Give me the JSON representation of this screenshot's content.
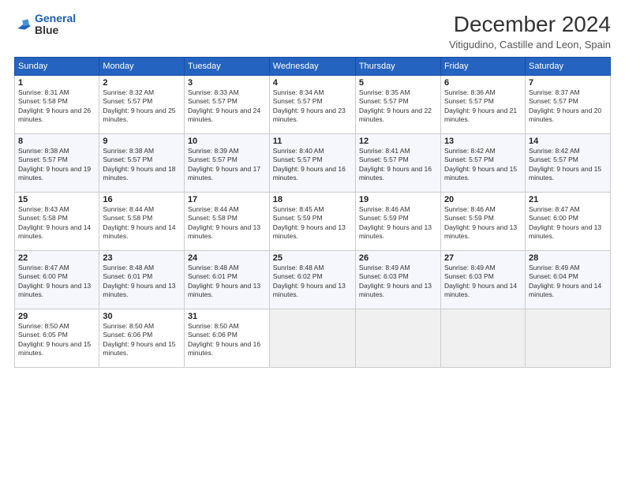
{
  "logo": {
    "line1": "General",
    "line2": "Blue"
  },
  "title": "December 2024",
  "subtitle": "Vitigudino, Castille and Leon, Spain",
  "weekdays": [
    "Sunday",
    "Monday",
    "Tuesday",
    "Wednesday",
    "Thursday",
    "Friday",
    "Saturday"
  ],
  "weeks": [
    [
      {
        "day": 1,
        "sunrise": "8:31 AM",
        "sunset": "5:58 PM",
        "daylight": "9 hours and 26 minutes."
      },
      {
        "day": 2,
        "sunrise": "8:32 AM",
        "sunset": "5:57 PM",
        "daylight": "9 hours and 25 minutes."
      },
      {
        "day": 3,
        "sunrise": "8:33 AM",
        "sunset": "5:57 PM",
        "daylight": "9 hours and 24 minutes."
      },
      {
        "day": 4,
        "sunrise": "8:34 AM",
        "sunset": "5:57 PM",
        "daylight": "9 hours and 23 minutes."
      },
      {
        "day": 5,
        "sunrise": "8:35 AM",
        "sunset": "5:57 PM",
        "daylight": "9 hours and 22 minutes."
      },
      {
        "day": 6,
        "sunrise": "8:36 AM",
        "sunset": "5:57 PM",
        "daylight": "9 hours and 21 minutes."
      },
      {
        "day": 7,
        "sunrise": "8:37 AM",
        "sunset": "5:57 PM",
        "daylight": "9 hours and 20 minutes."
      }
    ],
    [
      {
        "day": 8,
        "sunrise": "8:38 AM",
        "sunset": "5:57 PM",
        "daylight": "9 hours and 19 minutes."
      },
      {
        "day": 9,
        "sunrise": "8:38 AM",
        "sunset": "5:57 PM",
        "daylight": "9 hours and 18 minutes."
      },
      {
        "day": 10,
        "sunrise": "8:39 AM",
        "sunset": "5:57 PM",
        "daylight": "9 hours and 17 minutes."
      },
      {
        "day": 11,
        "sunrise": "8:40 AM",
        "sunset": "5:57 PM",
        "daylight": "9 hours and 16 minutes."
      },
      {
        "day": 12,
        "sunrise": "8:41 AM",
        "sunset": "5:57 PM",
        "daylight": "9 hours and 16 minutes."
      },
      {
        "day": 13,
        "sunrise": "8:42 AM",
        "sunset": "5:57 PM",
        "daylight": "9 hours and 15 minutes."
      },
      {
        "day": 14,
        "sunrise": "8:42 AM",
        "sunset": "5:57 PM",
        "daylight": "9 hours and 15 minutes."
      }
    ],
    [
      {
        "day": 15,
        "sunrise": "8:43 AM",
        "sunset": "5:58 PM",
        "daylight": "9 hours and 14 minutes."
      },
      {
        "day": 16,
        "sunrise": "8:44 AM",
        "sunset": "5:58 PM",
        "daylight": "9 hours and 14 minutes."
      },
      {
        "day": 17,
        "sunrise": "8:44 AM",
        "sunset": "5:58 PM",
        "daylight": "9 hours and 13 minutes."
      },
      {
        "day": 18,
        "sunrise": "8:45 AM",
        "sunset": "5:59 PM",
        "daylight": "9 hours and 13 minutes."
      },
      {
        "day": 19,
        "sunrise": "8:46 AM",
        "sunset": "5:59 PM",
        "daylight": "9 hours and 13 minutes."
      },
      {
        "day": 20,
        "sunrise": "8:46 AM",
        "sunset": "5:59 PM",
        "daylight": "9 hours and 13 minutes."
      },
      {
        "day": 21,
        "sunrise": "8:47 AM",
        "sunset": "6:00 PM",
        "daylight": "9 hours and 13 minutes."
      }
    ],
    [
      {
        "day": 22,
        "sunrise": "8:47 AM",
        "sunset": "6:00 PM",
        "daylight": "9 hours and 13 minutes."
      },
      {
        "day": 23,
        "sunrise": "8:48 AM",
        "sunset": "6:01 PM",
        "daylight": "9 hours and 13 minutes."
      },
      {
        "day": 24,
        "sunrise": "8:48 AM",
        "sunset": "6:01 PM",
        "daylight": "9 hours and 13 minutes."
      },
      {
        "day": 25,
        "sunrise": "8:48 AM",
        "sunset": "6:02 PM",
        "daylight": "9 hours and 13 minutes."
      },
      {
        "day": 26,
        "sunrise": "8:49 AM",
        "sunset": "6:03 PM",
        "daylight": "9 hours and 13 minutes."
      },
      {
        "day": 27,
        "sunrise": "8:49 AM",
        "sunset": "6:03 PM",
        "daylight": "9 hours and 14 minutes."
      },
      {
        "day": 28,
        "sunrise": "8:49 AM",
        "sunset": "6:04 PM",
        "daylight": "9 hours and 14 minutes."
      }
    ],
    [
      {
        "day": 29,
        "sunrise": "8:50 AM",
        "sunset": "6:05 PM",
        "daylight": "9 hours and 15 minutes."
      },
      {
        "day": 30,
        "sunrise": "8:50 AM",
        "sunset": "6:06 PM",
        "daylight": "9 hours and 15 minutes."
      },
      {
        "day": 31,
        "sunrise": "8:50 AM",
        "sunset": "6:06 PM",
        "daylight": "9 hours and 16 minutes."
      },
      null,
      null,
      null,
      null
    ]
  ],
  "labels": {
    "sunrise": "Sunrise:",
    "sunset": "Sunset:",
    "daylight": "Daylight:"
  },
  "colors": {
    "header_bg": "#2563c0",
    "even_row": "#f5f7fc"
  }
}
